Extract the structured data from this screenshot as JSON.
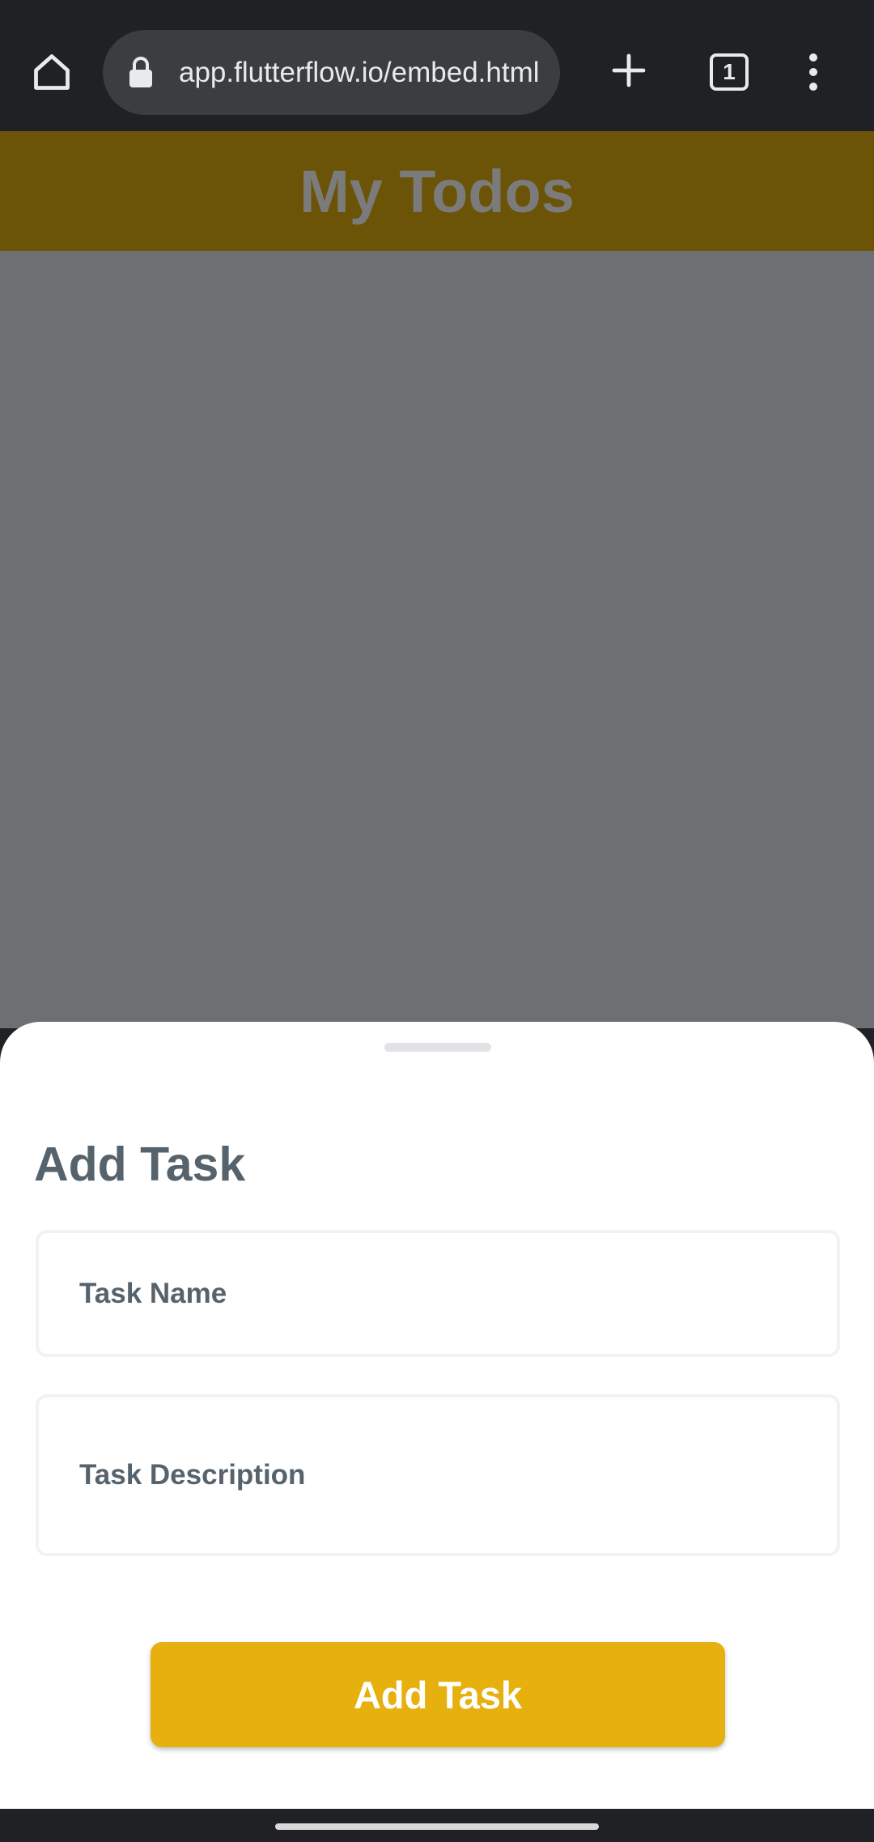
{
  "browser": {
    "url": "app.flutterflow.io/embed.html",
    "tab_count": "1",
    "icons": {
      "home": "home-icon",
      "lock": "lock-icon",
      "new_tab": "plus-icon",
      "tabs": "tab-switcher-icon",
      "menu": "more-vert-icon"
    }
  },
  "app": {
    "title": "My Todos",
    "colors": {
      "header_dimmed": "#6b5307",
      "overlay": "#6e6f72"
    }
  },
  "sheet": {
    "title": "Add Task",
    "task_name_placeholder": "Task Name",
    "task_description_placeholder": "Task Description",
    "submit_label": "Add Task",
    "colors": {
      "accent": "#e6b00f",
      "text": "#57636c"
    }
  }
}
